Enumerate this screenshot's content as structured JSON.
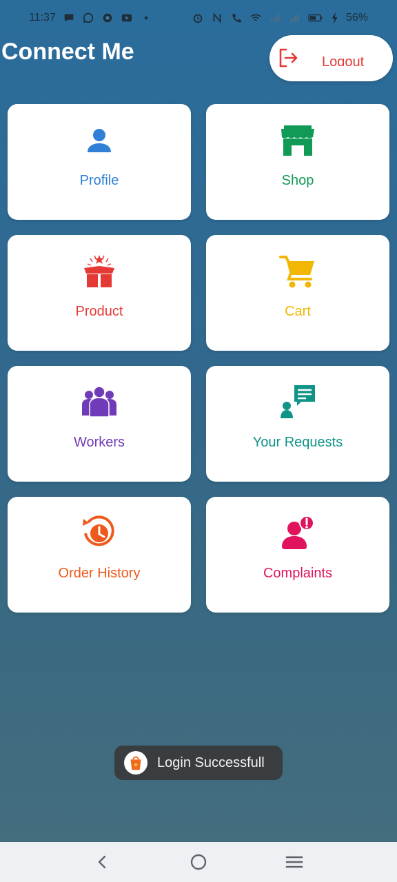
{
  "status_bar": {
    "time": "11:37",
    "battery": "56%",
    "left_icons": [
      "chat-bubble-icon",
      "whatsapp-icon",
      "shield-app-icon",
      "youtube-icon",
      "dot-icon"
    ],
    "right_icons": [
      "alarm-icon",
      "nfc-icon",
      "volte-call-icon",
      "wifi-icon",
      "signal-icon",
      "signal-icon",
      "battery-icon",
      "charging-icon"
    ]
  },
  "app": {
    "title": "Connect Me",
    "logout_label": "Logout",
    "logout_icon": "logout-icon"
  },
  "tiles": [
    {
      "label": "Profile",
      "icon": "person-icon",
      "color": "#2f80d6"
    },
    {
      "label": "Shop",
      "icon": "storefront-icon",
      "color": "#109a55"
    },
    {
      "label": "Product",
      "icon": "gift-box-icon",
      "color": "#e53935"
    },
    {
      "label": "Cart",
      "icon": "shopping-cart-icon",
      "color": "#f2b705"
    },
    {
      "label": "Workers",
      "icon": "group-icon",
      "color": "#6f3bb8"
    },
    {
      "label": "Your Requests",
      "icon": "chat-request-icon",
      "color": "#0f9488"
    },
    {
      "label": "Order History",
      "icon": "history-clock-icon",
      "color": "#ee5a1c"
    },
    {
      "label": "Complaints",
      "icon": "person-alert-icon",
      "color": "#e0145e"
    }
  ],
  "toast": {
    "message": "Login Successfull",
    "icon": "shopping-bag-logo-icon"
  },
  "nav": {
    "icons": [
      "back-icon",
      "home-icon",
      "recents-icon"
    ]
  }
}
